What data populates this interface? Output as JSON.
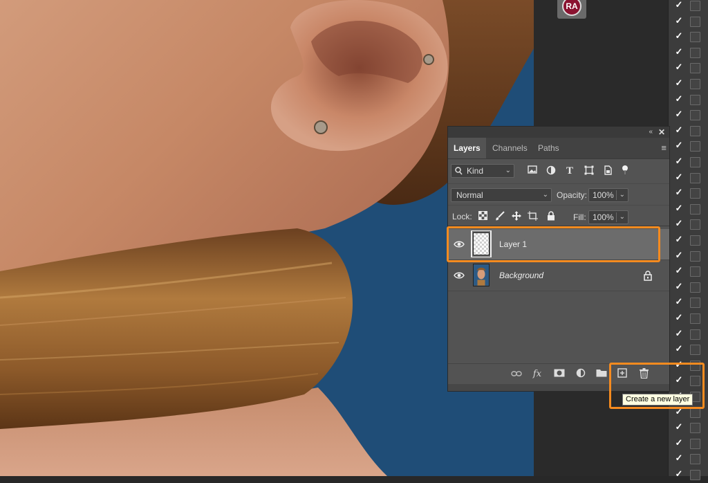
{
  "user_badge": {
    "initials": "RA",
    "color": "#8a1230"
  },
  "layers_panel": {
    "topbar": {
      "collapse_icon": "double-chevron-right",
      "close_icon": "close"
    },
    "tabs": [
      {
        "label": "Layers",
        "active": true
      },
      {
        "label": "Channels",
        "active": false
      },
      {
        "label": "Paths",
        "active": false
      }
    ],
    "filter": {
      "kind_label": "Kind",
      "icons": [
        "image-filter-icon",
        "adjustment-filter-icon",
        "type-filter-icon",
        "shape-filter-icon",
        "smart-object-filter-icon"
      ]
    },
    "blend_mode": "Normal",
    "opacity_label": "Opacity:",
    "opacity_value": "100%",
    "lock_label": "Lock:",
    "fill_label": "Fill:",
    "fill_value": "100%",
    "layers": [
      {
        "name": "Layer 1",
        "visible": true,
        "selected": true,
        "thumbnail": "transparent"
      },
      {
        "name": "Background",
        "visible": true,
        "selected": false,
        "thumbnail": "photo",
        "locked": true
      }
    ],
    "bottom_icons": [
      "link-layers-icon",
      "fx-icon",
      "add-mask-icon",
      "adjustment-layer-icon",
      "new-group-icon",
      "new-layer-icon",
      "delete-layer-icon"
    ],
    "fx_label": "fx"
  },
  "tooltip": {
    "text": "Create a new layer"
  },
  "highlight_color": "#f68b1f",
  "checkbox_strip": {
    "rows": 31,
    "tick": "✓"
  }
}
